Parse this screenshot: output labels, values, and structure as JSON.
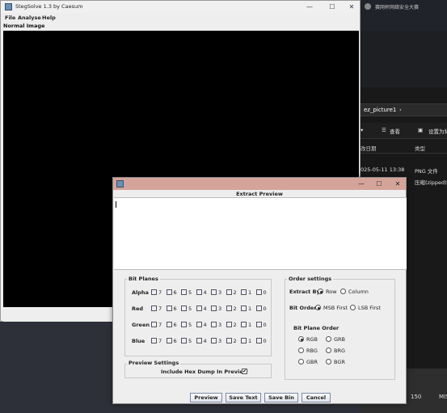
{
  "background": {
    "top_tab_text": "赛网杯网络安全大赛",
    "explorer": {
      "address_crumb": "ez_picture1",
      "toolbar": {
        "sort_label": "查看",
        "setting_label": "设置为背"
      },
      "columns": {
        "modified": "改日期",
        "type": "类型"
      },
      "rows": [
        {
          "modified": "025-05-11 13:38",
          "type": "PNG 文件"
        },
        {
          "modified": "",
          "type": "压缩(zipped)文"
        }
      ],
      "bottom": {
        "size_value": "150",
        "misc": "MIS"
      }
    }
  },
  "stegsolve": {
    "title": "StegSolve 1.3 by Caesum",
    "menu": [
      "File",
      "Analyse",
      "Help"
    ],
    "image_label": "Normal Image",
    "controls": {
      "minimize": "—",
      "maximize": "☐",
      "close": "✕"
    }
  },
  "extract": {
    "heading": "Extract Preview",
    "controls": {
      "minimize": "—",
      "maximize": "☐",
      "close": "✕"
    },
    "text_value": "",
    "bit_planes": {
      "title": "Bit Planes",
      "channels": [
        "Alpha",
        "Red",
        "Green",
        "Blue"
      ],
      "bits": [
        "7",
        "6",
        "5",
        "4",
        "3",
        "2",
        "1",
        "0"
      ]
    },
    "preview_settings": {
      "title": "Preview Settings",
      "hex_dump_label": "Include Hex Dump In Preview",
      "hex_dump_checked": true,
      "check_mark": "✔"
    },
    "order_settings": {
      "title": "Order settings",
      "extract_by_label": "Extract By",
      "extract_by_options": [
        "Row",
        "Column"
      ],
      "extract_by_selected": "Row",
      "bit_order_label": "Bit Order",
      "bit_order_options": [
        "MSB First",
        "LSB First"
      ],
      "bit_order_selected": "MSB First",
      "plane_order_label": "Bit Plane Order",
      "plane_order_options": [
        "RGB",
        "GRB",
        "RBG",
        "BRG",
        "GBR",
        "BGR"
      ],
      "plane_order_selected": "RGB"
    },
    "buttons": {
      "preview": "Preview",
      "save_text": "Save Text",
      "save_bin": "Save Bin",
      "cancel": "Cancel"
    }
  }
}
